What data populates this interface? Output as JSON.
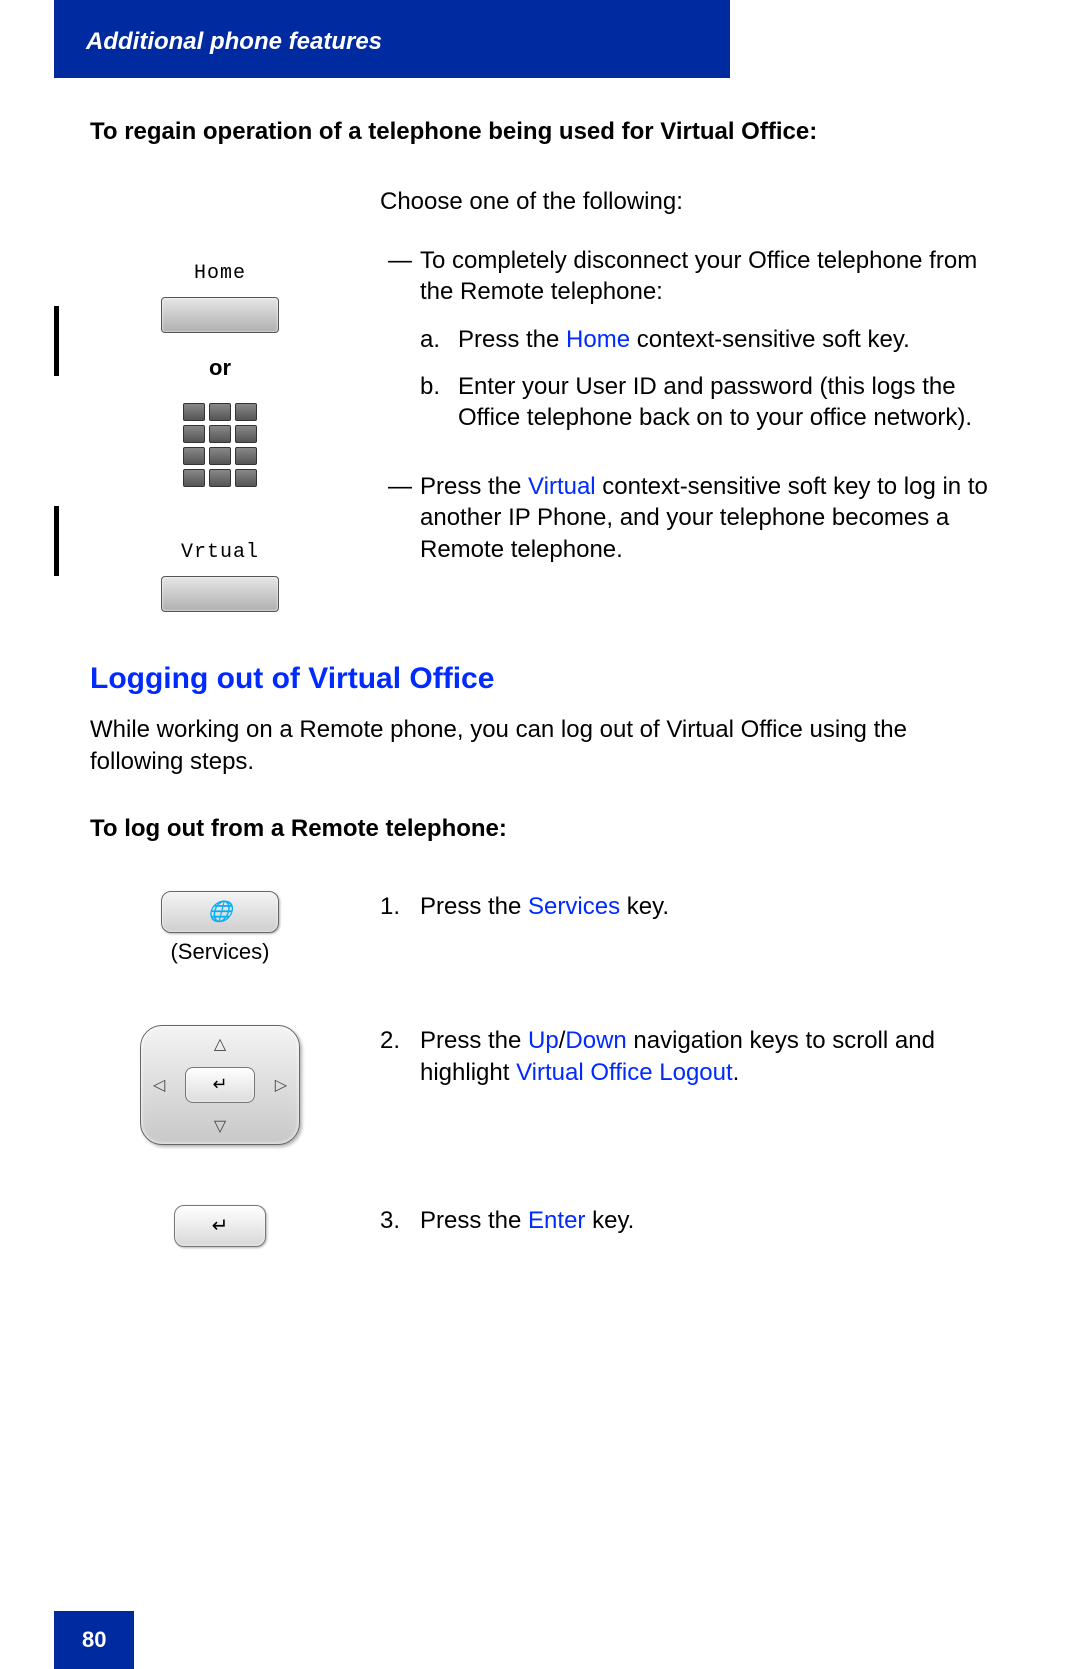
{
  "header": "Additional phone features",
  "section1_title": "To regain operation of a telephone being used for Virtual Office:",
  "choose_line": "Choose one of the following:",
  "softkeys": {
    "home": "Home",
    "virtual": "Vrtual",
    "or": "or"
  },
  "bullet1": "To completely disconnect your Office telephone from the Remote telephone:",
  "step_a": {
    "label": "a.",
    "pre": "Press the ",
    "key": "Home",
    "post": " context-sensitive soft key."
  },
  "step_b": {
    "label": "b.",
    "text": "Enter your User ID and password (this logs the Office telephone back on to your office network)."
  },
  "bullet2": {
    "pre": "Press the ",
    "key": "Virtual",
    "post": " context-sensitive soft key to log in to another IP Phone, and your telephone becomes a Remote telephone."
  },
  "h2": "Logging out of Virtual Office",
  "para": "While working on a Remote phone, you can log out of Virtual Office using the following steps.",
  "sub_bold": "To log out from a Remote telephone:",
  "services_caption": "(Services)",
  "steps": {
    "s1": {
      "num": "1.",
      "pre": "Press the ",
      "key": "Services",
      "post": " key."
    },
    "s2": {
      "num": "2.",
      "pre": "Press the ",
      "key1": "Up",
      "slash": "/",
      "key2": "Down",
      "mid": " navigation keys to scroll and highlight ",
      "key3": "Virtual Office Logout",
      "post": "."
    },
    "s3": {
      "num": "3.",
      "pre": "Press the ",
      "key": "Enter",
      "post": " key."
    }
  },
  "page_number": "80"
}
